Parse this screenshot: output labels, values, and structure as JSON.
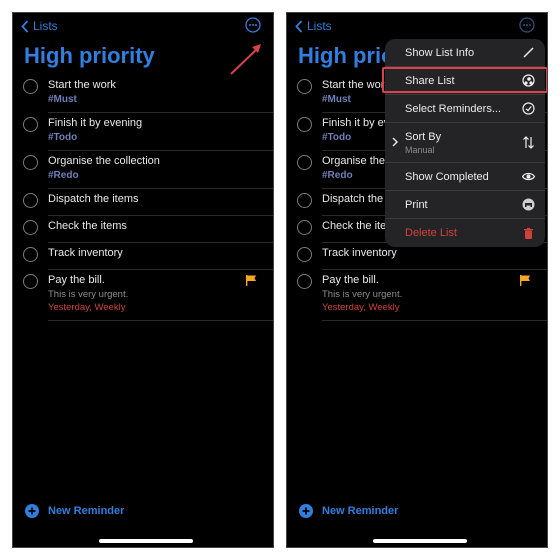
{
  "nav": {
    "back_label": "Lists"
  },
  "list_title": "High priority",
  "reminders": [
    {
      "title": "Start the work",
      "tag": "#Must"
    },
    {
      "title": "Finish it by evening",
      "tag": "#Todo"
    },
    {
      "title": "Organise the collection",
      "tag": "#Redo"
    },
    {
      "title": "Dispatch the items"
    },
    {
      "title": "Check the items"
    },
    {
      "title": "Track inventory"
    },
    {
      "title": "Pay the bill.",
      "note": "This is very urgent.",
      "due": "Yesterday, Weekly",
      "flagged": true
    }
  ],
  "new_reminder_label": "New Reminder",
  "menu": {
    "items": [
      {
        "label": "Show List Info",
        "icon": "pencil-icon"
      },
      {
        "label": "Share List",
        "icon": "share-people-icon",
        "highlighted": true
      },
      {
        "label": "Select Reminders...",
        "icon": "checkmark-circle-icon"
      },
      {
        "label": "Sort By",
        "sublabel": "Manual",
        "icon": "sort-arrows-icon",
        "has_submenu": true
      },
      {
        "label": "Show Completed",
        "icon": "eye-icon"
      },
      {
        "label": "Print",
        "icon": "printer-icon"
      },
      {
        "label": "Delete List",
        "icon": "trash-icon",
        "destructive": true
      }
    ]
  },
  "colors": {
    "accent": "#2f7fe0",
    "destructive": "#d0413b",
    "tag": "#6f7fb8",
    "flag": "#f5a623",
    "annotation": "#d9424a"
  }
}
